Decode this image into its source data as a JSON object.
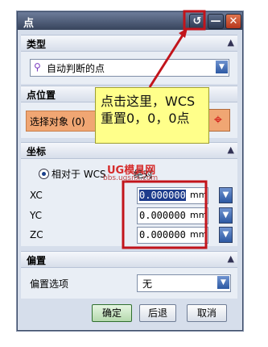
{
  "window": {
    "title": "点",
    "reset_icon": "↺",
    "min_icon": "—",
    "close_icon": "✕"
  },
  "sections": {
    "type": {
      "label": "类型",
      "value": "自动判断的点",
      "icon": "⚲"
    },
    "point_position": {
      "label": "点位置",
      "select_label": "选择对象 (0)"
    },
    "coords": {
      "label": "坐标",
      "radio_label": "相对于 WCS",
      "radio_label2": "绝对",
      "xc_label": "XC",
      "xc_value": "0.000000",
      "xc_unit": "mm",
      "yc_label": "YC",
      "yc_value": "0.000000",
      "yc_unit": "mm",
      "zc_label": "ZC",
      "zc_value": "0.000000",
      "zc_unit": "mm"
    },
    "offset": {
      "label": "偏置",
      "option_label": "偏置选项",
      "option_value": "无"
    }
  },
  "buttons": {
    "ok": "确定",
    "back": "后退",
    "cancel": "取消"
  },
  "annotation": {
    "line1": "点击这里，WCS",
    "line2": "重置0，0，0点"
  },
  "watermark": {
    "line1": "UG模具网",
    "line2": "bbs.ugsnx.com"
  },
  "colors": {
    "annotation_red": "#c2141b",
    "title_bar": "#37445c",
    "callout_bg": "#ffff8a"
  }
}
